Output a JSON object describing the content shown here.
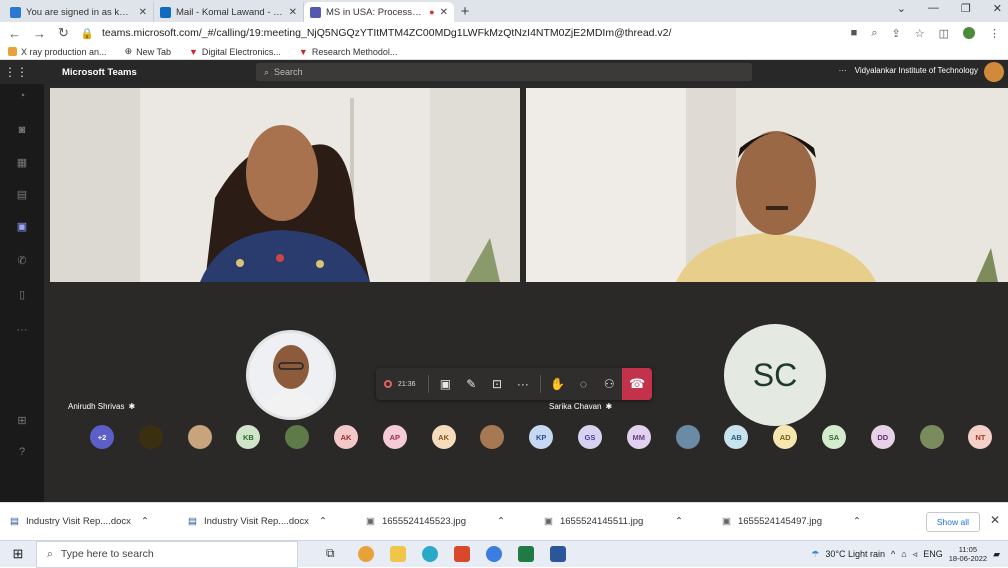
{
  "browser": {
    "tabs": [
      {
        "title": "You are signed in as komal.lawan",
        "icon_color": "#2a7ad1",
        "active": false
      },
      {
        "title": "Mail - Komal Lawand - Outlook",
        "icon_color": "#0f6cbd",
        "active": false
      },
      {
        "title": "MS in USA: Process, Exams",
        "icon_color": "#5558af",
        "active": true
      }
    ],
    "new_tab": "+",
    "address": "teams.microsoft.com/_#/calling/19:meeting_NjQ5NGQzYTItMTM4ZC00MDg1LWFkMzQtNzI4NTM0ZjE2MDIm@thread.v2/",
    "bookmarks": [
      "X ray production an...",
      "New Tab",
      "Digital Electronics...",
      "Research Methodol..."
    ]
  },
  "teams": {
    "app_name": "Microsoft Teams",
    "search_placeholder": "Search",
    "org": "Vidyalankar Institute of Technology",
    "org_ellipsis": "···",
    "rail": [
      "Activity",
      "Chat",
      "Teams",
      "Assignments",
      "Calendar",
      "Calls",
      "Files",
      "···",
      "Apps",
      "Help"
    ],
    "participants_main": [
      {
        "name": "Anirudh Shrivas",
        "mic": "muted"
      },
      {
        "name": "Sarika Chavan",
        "initials": "SC",
        "mic": "muted"
      }
    ],
    "controls": {
      "timer": "21:36",
      "hangup": "leave"
    },
    "strip": [
      {
        "label": "+2",
        "bg": "#5b5fc7",
        "fg": "#fff"
      },
      {
        "label": "",
        "bg": "#3b2f12",
        "fg": "#fff"
      },
      {
        "label": "",
        "bg": "#c7a47c",
        "fg": "#fff"
      },
      {
        "label": "KB",
        "bg": "#cfe4c8",
        "fg": "#2f6b2f"
      },
      {
        "label": "",
        "bg": "#5e7a48",
        "fg": "#fff"
      },
      {
        "label": "AK",
        "bg": "#f2c8c8",
        "fg": "#9b3030"
      },
      {
        "label": "AP",
        "bg": "#f4cbd6",
        "fg": "#9a2c54"
      },
      {
        "label": "AK",
        "bg": "#f5dcbc",
        "fg": "#8a5416"
      },
      {
        "label": "",
        "bg": "#a77853",
        "fg": "#fff"
      },
      {
        "label": "KP",
        "bg": "#c7d8f2",
        "fg": "#2a4f8c"
      },
      {
        "label": "GS",
        "bg": "#d7d2f0",
        "fg": "#4a3c9a"
      },
      {
        "label": "MM",
        "bg": "#e0d2ee",
        "fg": "#6a3c8c"
      },
      {
        "label": "",
        "bg": "#6b8aa6",
        "fg": "#fff"
      },
      {
        "label": "AB",
        "bg": "#c8e2ee",
        "fg": "#1f5c77"
      },
      {
        "label": "AD",
        "bg": "#f6e6b0",
        "fg": "#7a5c0c"
      },
      {
        "label": "SA",
        "bg": "#d4ebce",
        "fg": "#2f6b2f"
      },
      {
        "label": "DD",
        "bg": "#e6d2e6",
        "fg": "#6a3070"
      },
      {
        "label": "",
        "bg": "#7a8c5e",
        "fg": "#fff"
      },
      {
        "label": "NT",
        "bg": "#f5d0c8",
        "fg": "#9b3a26"
      }
    ]
  },
  "downloads": {
    "items": [
      "Industry Visit Rep....docx",
      "Industry Visit Rep....docx",
      "1655524145523.jpg",
      "1655524145511.jpg",
      "1655524145497.jpg"
    ],
    "show_all": "Show all",
    "close": "✕"
  },
  "taskbar": {
    "search_placeholder": "Type here to search",
    "weather": "30°C  Light rain",
    "lang": "ENG",
    "time": "11:05",
    "date": "18-06-2022"
  }
}
